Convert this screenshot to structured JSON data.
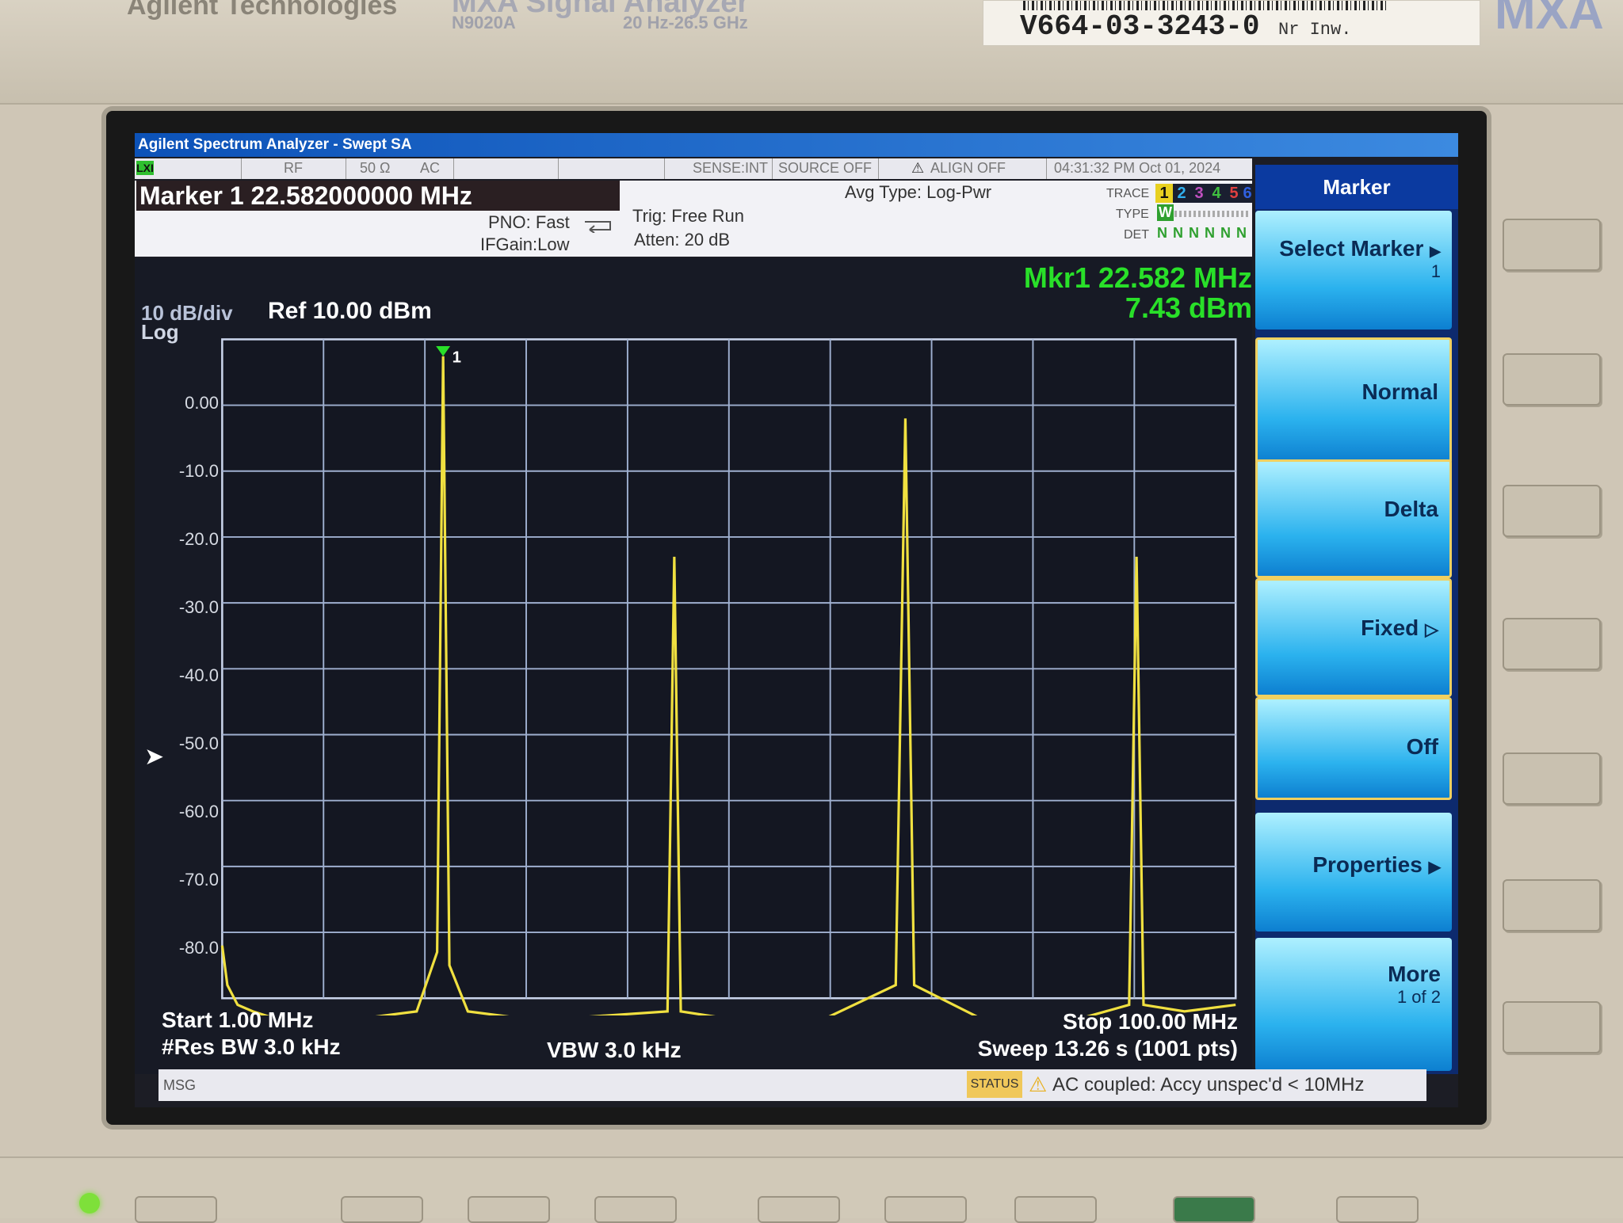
{
  "instrument": {
    "brand": "Agilent Technologies",
    "model_name": "MXA Signal Analyzer",
    "model_number": "N9020A",
    "freq_range": "20 Hz-26.5 GHz",
    "logo": "MXA",
    "asset_code": "V664-03-3243-0",
    "asset_label": "Nr Inw."
  },
  "window_title": "Agilent Spectrum Analyzer - Swept SA",
  "status_row": {
    "input": "RF",
    "impedance": "50 Ω",
    "coupling": "AC",
    "sense": "SENSE:INT",
    "source": "SOURCE OFF",
    "align": "ALIGN OFF",
    "datetime": "04:31:32 PM Oct 01, 2024"
  },
  "info": {
    "marker_title": "Marker 1 22.582000000 MHz",
    "pno": "PNO: Fast",
    "ifgain": "IFGain:Low",
    "trig": "Trig: Free Run",
    "atten": "Atten: 20 dB",
    "avg_type": "Avg Type: Log-Pwr",
    "trace_label": "TRACE",
    "type_label": "TYPE",
    "det_label": "DET",
    "traces": [
      "1",
      "2",
      "3",
      "4",
      "5",
      "6"
    ],
    "trace_colors": [
      "#e8d020",
      "#30b0f0",
      "#c050c0",
      "#40c040",
      "#e04040",
      "#3060e0"
    ],
    "type_value": "W",
    "det_values": [
      "N",
      "N",
      "N",
      "N",
      "N",
      "N"
    ]
  },
  "plot": {
    "scale": "10 dB/div",
    "scale_type": "Log",
    "ref_level": "Ref 10.00 dBm",
    "marker_readout_freq": "Mkr1 22.582 MHz",
    "marker_readout_amp": "7.43 dBm",
    "marker_tag": "1",
    "y_tick_labels": [
      "0.00",
      "-10.0",
      "-20.0",
      "-30.0",
      "-40.0",
      "-50.0",
      "-60.0",
      "-70.0",
      "-80.0"
    ],
    "start": "Start 1.00 MHz",
    "stop": "Stop 100.00 MHz",
    "rbw": "#Res BW 3.0 kHz",
    "vbw": "VBW 3.0 kHz",
    "sweep": "Sweep  13.26 s (1001 pts)",
    "trace_color": "#f0e040"
  },
  "chart_data": {
    "type": "line",
    "xlabel": "",
    "ylabel": "",
    "xlim": [
      1.0,
      100.0
    ],
    "ylim": [
      -90,
      10
    ],
    "grid": true,
    "series": [
      {
        "x": [
          1.0,
          1.5,
          2.5,
          4,
          6,
          10,
          15,
          20,
          22.0,
          22.58,
          23.2,
          25,
          30,
          35,
          44.5,
          45.16,
          45.8,
          50,
          60,
          66.8,
          67.74,
          68.6,
          75,
          85,
          89.6,
          90.32,
          91,
          95,
          100
        ],
        "y": [
          -82,
          -88,
          -91,
          -92,
          -93,
          -93,
          -93,
          -92,
          -83,
          7.43,
          -85,
          -92,
          -93,
          -93,
          -92,
          -23,
          -92,
          -93,
          -93,
          -88,
          -2,
          -88,
          -93,
          -93,
          -91,
          -23,
          -91,
          -92,
          -91
        ]
      }
    ]
  },
  "softkeys": {
    "menu_title": "Marker",
    "select_marker": "Select Marker",
    "select_marker_value": "1",
    "normal": "Normal",
    "delta": "Delta",
    "fixed": "Fixed",
    "off": "Off",
    "properties": "Properties",
    "more": "More",
    "more_sub": "1 of 2"
  },
  "msgbar": {
    "msg_label": "MSG",
    "status_label": "STATUS",
    "warning": "AC coupled: Accy unspec'd < 10MHz"
  }
}
